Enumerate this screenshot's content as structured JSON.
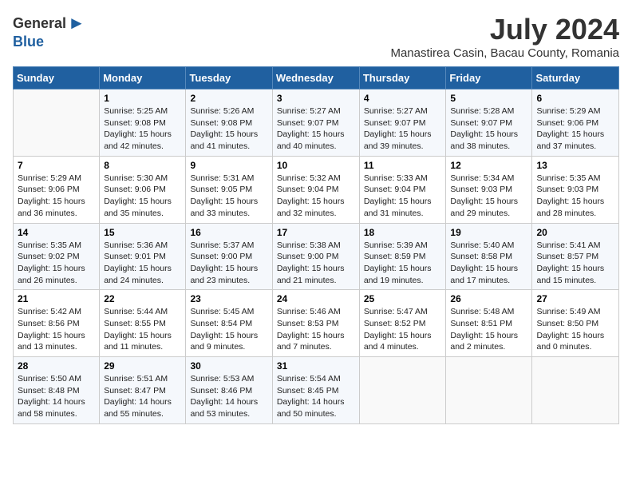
{
  "header": {
    "logo_general": "General",
    "logo_blue": "Blue",
    "month": "July 2024",
    "location": "Manastirea Casin, Bacau County, Romania"
  },
  "days_of_week": [
    "Sunday",
    "Monday",
    "Tuesday",
    "Wednesday",
    "Thursday",
    "Friday",
    "Saturday"
  ],
  "weeks": [
    [
      {
        "day": "",
        "info": ""
      },
      {
        "day": "1",
        "info": "Sunrise: 5:25 AM\nSunset: 9:08 PM\nDaylight: 15 hours\nand 42 minutes."
      },
      {
        "day": "2",
        "info": "Sunrise: 5:26 AM\nSunset: 9:08 PM\nDaylight: 15 hours\nand 41 minutes."
      },
      {
        "day": "3",
        "info": "Sunrise: 5:27 AM\nSunset: 9:07 PM\nDaylight: 15 hours\nand 40 minutes."
      },
      {
        "day": "4",
        "info": "Sunrise: 5:27 AM\nSunset: 9:07 PM\nDaylight: 15 hours\nand 39 minutes."
      },
      {
        "day": "5",
        "info": "Sunrise: 5:28 AM\nSunset: 9:07 PM\nDaylight: 15 hours\nand 38 minutes."
      },
      {
        "day": "6",
        "info": "Sunrise: 5:29 AM\nSunset: 9:06 PM\nDaylight: 15 hours\nand 37 minutes."
      }
    ],
    [
      {
        "day": "7",
        "info": "Sunrise: 5:29 AM\nSunset: 9:06 PM\nDaylight: 15 hours\nand 36 minutes."
      },
      {
        "day": "8",
        "info": "Sunrise: 5:30 AM\nSunset: 9:06 PM\nDaylight: 15 hours\nand 35 minutes."
      },
      {
        "day": "9",
        "info": "Sunrise: 5:31 AM\nSunset: 9:05 PM\nDaylight: 15 hours\nand 33 minutes."
      },
      {
        "day": "10",
        "info": "Sunrise: 5:32 AM\nSunset: 9:04 PM\nDaylight: 15 hours\nand 32 minutes."
      },
      {
        "day": "11",
        "info": "Sunrise: 5:33 AM\nSunset: 9:04 PM\nDaylight: 15 hours\nand 31 minutes."
      },
      {
        "day": "12",
        "info": "Sunrise: 5:34 AM\nSunset: 9:03 PM\nDaylight: 15 hours\nand 29 minutes."
      },
      {
        "day": "13",
        "info": "Sunrise: 5:35 AM\nSunset: 9:03 PM\nDaylight: 15 hours\nand 28 minutes."
      }
    ],
    [
      {
        "day": "14",
        "info": "Sunrise: 5:35 AM\nSunset: 9:02 PM\nDaylight: 15 hours\nand 26 minutes."
      },
      {
        "day": "15",
        "info": "Sunrise: 5:36 AM\nSunset: 9:01 PM\nDaylight: 15 hours\nand 24 minutes."
      },
      {
        "day": "16",
        "info": "Sunrise: 5:37 AM\nSunset: 9:00 PM\nDaylight: 15 hours\nand 23 minutes."
      },
      {
        "day": "17",
        "info": "Sunrise: 5:38 AM\nSunset: 9:00 PM\nDaylight: 15 hours\nand 21 minutes."
      },
      {
        "day": "18",
        "info": "Sunrise: 5:39 AM\nSunset: 8:59 PM\nDaylight: 15 hours\nand 19 minutes."
      },
      {
        "day": "19",
        "info": "Sunrise: 5:40 AM\nSunset: 8:58 PM\nDaylight: 15 hours\nand 17 minutes."
      },
      {
        "day": "20",
        "info": "Sunrise: 5:41 AM\nSunset: 8:57 PM\nDaylight: 15 hours\nand 15 minutes."
      }
    ],
    [
      {
        "day": "21",
        "info": "Sunrise: 5:42 AM\nSunset: 8:56 PM\nDaylight: 15 hours\nand 13 minutes."
      },
      {
        "day": "22",
        "info": "Sunrise: 5:44 AM\nSunset: 8:55 PM\nDaylight: 15 hours\nand 11 minutes."
      },
      {
        "day": "23",
        "info": "Sunrise: 5:45 AM\nSunset: 8:54 PM\nDaylight: 15 hours\nand 9 minutes."
      },
      {
        "day": "24",
        "info": "Sunrise: 5:46 AM\nSunset: 8:53 PM\nDaylight: 15 hours\nand 7 minutes."
      },
      {
        "day": "25",
        "info": "Sunrise: 5:47 AM\nSunset: 8:52 PM\nDaylight: 15 hours\nand 4 minutes."
      },
      {
        "day": "26",
        "info": "Sunrise: 5:48 AM\nSunset: 8:51 PM\nDaylight: 15 hours\nand 2 minutes."
      },
      {
        "day": "27",
        "info": "Sunrise: 5:49 AM\nSunset: 8:50 PM\nDaylight: 15 hours\nand 0 minutes."
      }
    ],
    [
      {
        "day": "28",
        "info": "Sunrise: 5:50 AM\nSunset: 8:48 PM\nDaylight: 14 hours\nand 58 minutes."
      },
      {
        "day": "29",
        "info": "Sunrise: 5:51 AM\nSunset: 8:47 PM\nDaylight: 14 hours\nand 55 minutes."
      },
      {
        "day": "30",
        "info": "Sunrise: 5:53 AM\nSunset: 8:46 PM\nDaylight: 14 hours\nand 53 minutes."
      },
      {
        "day": "31",
        "info": "Sunrise: 5:54 AM\nSunset: 8:45 PM\nDaylight: 14 hours\nand 50 minutes."
      },
      {
        "day": "",
        "info": ""
      },
      {
        "day": "",
        "info": ""
      },
      {
        "day": "",
        "info": ""
      }
    ]
  ]
}
